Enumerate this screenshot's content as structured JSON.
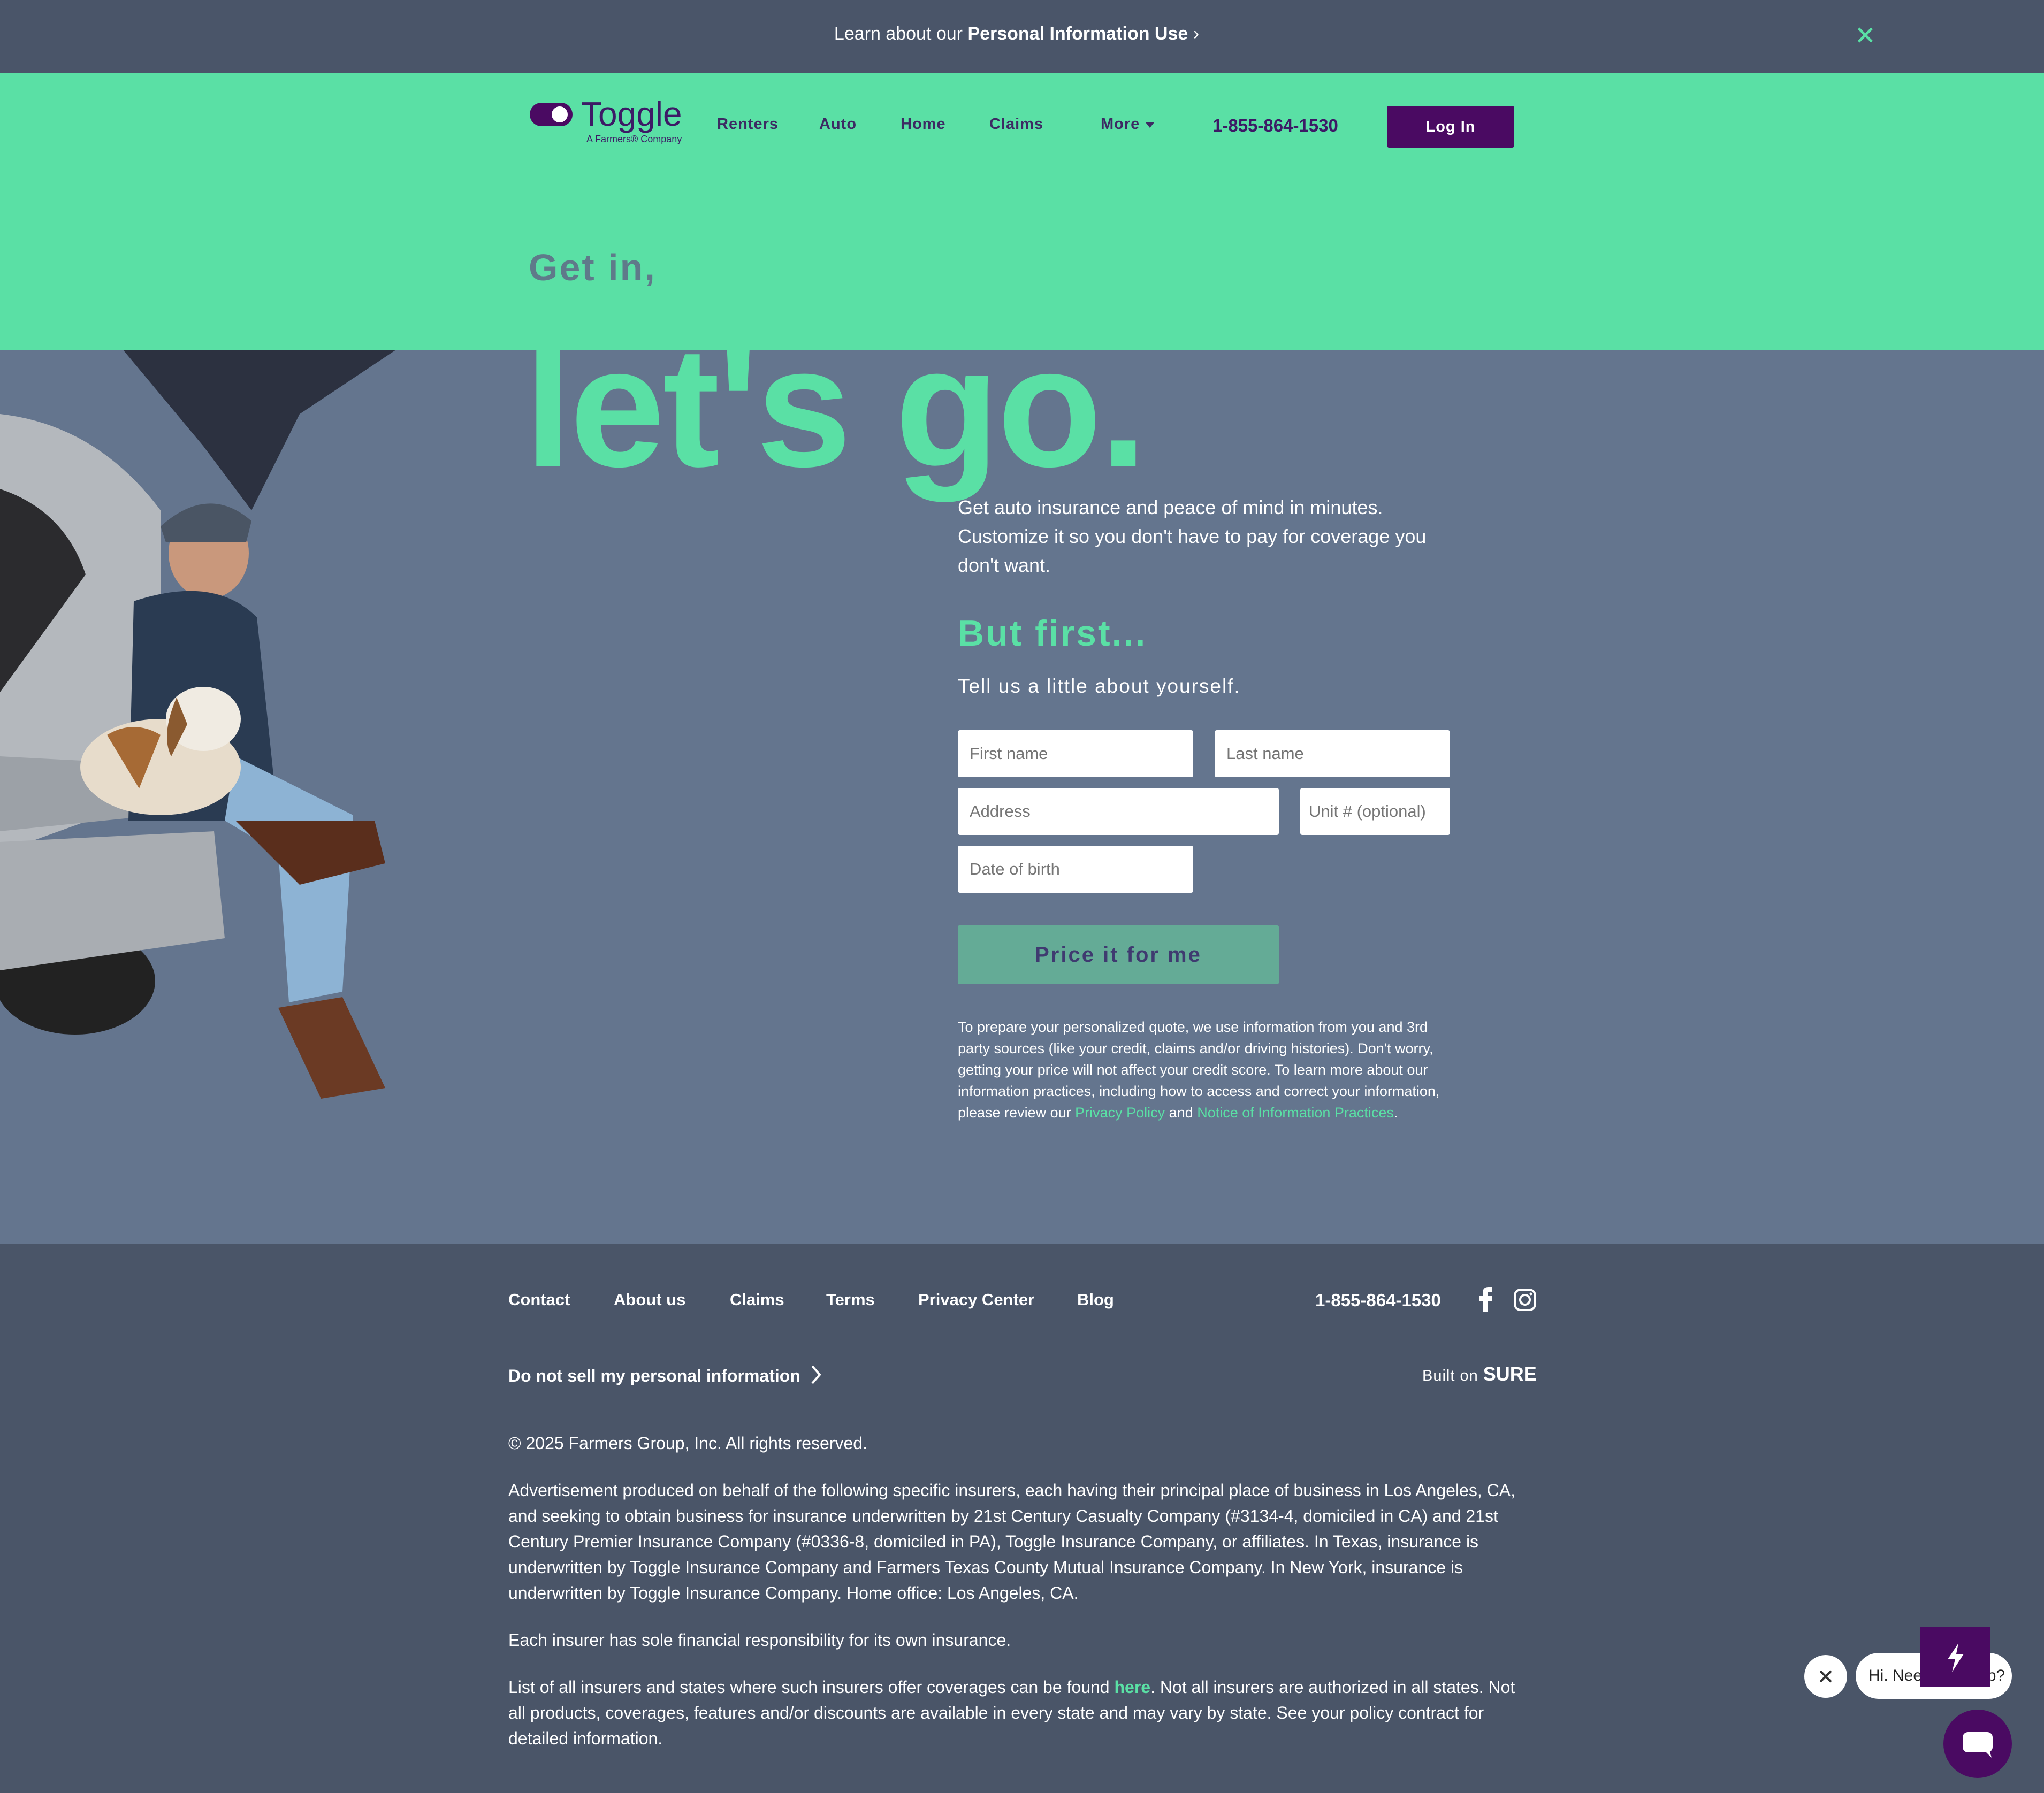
{
  "banner": {
    "prefix": "Learn about our ",
    "link": "Personal Information Use",
    "chevron": "›",
    "close": "✕"
  },
  "header": {
    "logo_text": "Toggle",
    "logo_sub": "A Farmers® Company",
    "nav": [
      "Renters",
      "Auto",
      "Home",
      "Claims",
      "More"
    ],
    "phone": "1-855-864-1530",
    "login": "Log In"
  },
  "hero": {
    "kicker": "Get in,",
    "headline": "let's go.",
    "intro": "Get auto insurance and peace of mind in minutes. Customize it so you don't have to pay for coverage you don't want.",
    "subhead": "But first...",
    "prompt": "Tell us a little about yourself.",
    "form": {
      "first_name": "First name",
      "last_name": "Last name",
      "address": "Address",
      "unit": "Unit # (optional)",
      "dob": "Date of birth",
      "submit": "Price it for me"
    },
    "disclaimer": {
      "text": "To prepare your personalized quote, we use information from you and 3rd party sources (like your credit, claims and/or driving histories). Don't worry, getting your price will not affect your credit score. To learn more about our information practices, including how to access and correct your information, please review our ",
      "privacy_link": "Privacy Policy",
      "and": " and ",
      "notice_link": "Notice of Information Practices",
      "end": "."
    }
  },
  "footer": {
    "nav": [
      "Contact",
      "About us",
      "Claims",
      "Terms",
      "Privacy Center",
      "Blog"
    ],
    "phone": "1-855-864-1530",
    "do_not_sell": "Do not sell my personal information",
    "built_on": "Built on ",
    "built_on_brand": "SURE",
    "copyright": "© 2025 Farmers Group, Inc. All rights reserved.",
    "ad_text": "Advertisement produced on behalf of the following specific insurers, each having their principal place of business in Los Angeles, CA, and seeking to obtain business for insurance underwritten by 21st Century Casualty Company (#3134-4, domiciled in CA) and 21st Century Premier Insurance Company (#0336-8, domiciled in PA), Toggle Insurance Company, or affiliates. In Texas, insurance is underwritten by Toggle Insurance Company and Farmers Texas County Mutual Insurance Company. In New York, insurance is underwritten by Toggle Insurance Company. Home office: Los Angeles, CA.",
    "responsibility": "Each insurer has sole financial responsibility for its own insurance.",
    "list_prefix": "List of all insurers and states where such insurers offer coverages can be found ",
    "list_link": "here",
    "list_suffix": ". Not all insurers are authorized in all states. Not all products, coverages, features and/or discounts are available in every state and may vary by state. See your policy contract for detailed information."
  },
  "chat": {
    "bubble": "Hi. Need any help?"
  },
  "colors": {
    "brand_green": "#5ae0a5",
    "brand_purple": "#4a0a62",
    "hero_bg": "#64758e",
    "footer_bg": "#4a5568"
  },
  "icons": [
    "close-icon",
    "chevron-right-icon",
    "caret-down-icon",
    "facebook-icon",
    "instagram-icon",
    "bolt-icon",
    "chat-icon"
  ]
}
